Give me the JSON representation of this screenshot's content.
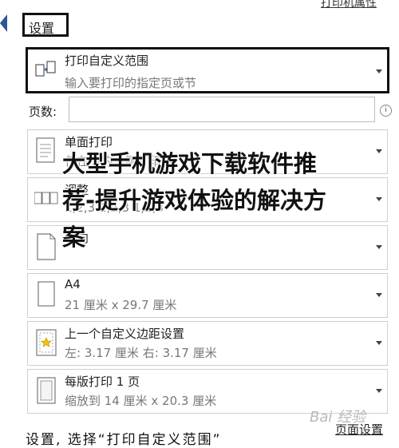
{
  "top_link": "打印机属性",
  "settings_label": "设置",
  "print_range": {
    "title": "打印自定义范围",
    "subtitle": "输入要打印的指定页或节"
  },
  "pages": {
    "label": "页数:",
    "value": "",
    "info": "i"
  },
  "sides": {
    "title": "单面打印",
    "subtitle": "仅在页的一侧打印"
  },
  "collate": {
    "title": "调整",
    "subtitle": "1,2,3    1,2,3    1,2,3"
  },
  "orientation": {
    "title": "纵向",
    "subtitle": ""
  },
  "paper": {
    "title": "A4",
    "subtitle": "21 厘米 x 29.7 厘米"
  },
  "margins": {
    "title": "上一个自定义边距设置",
    "subtitle": "左: 3.17 厘米    右: 3.17 厘米"
  },
  "pages_per_sheet": {
    "title": "每版打印 1 页",
    "subtitle": "缩放到 14 厘米 x 20.3 厘米"
  },
  "page_setup_link": "页面设置",
  "overlay_title": "大型手机游戏下载软件推荐-提升游戏体验的解决方案",
  "caption": "设置, 选择“打印自定义范围”",
  "watermark": "Bai 经验"
}
